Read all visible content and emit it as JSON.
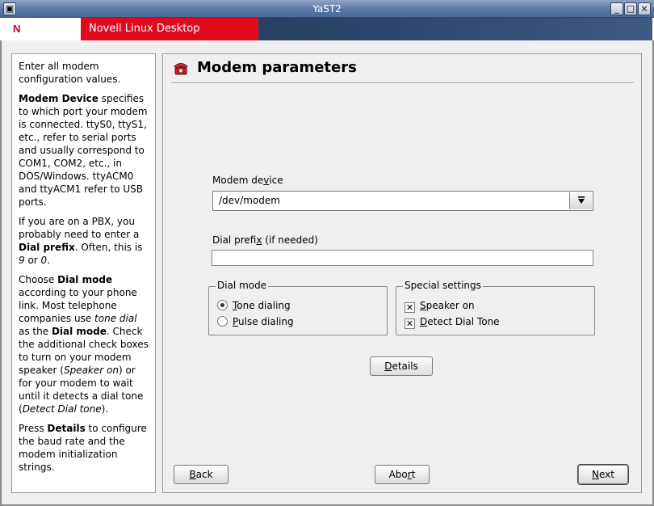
{
  "window": {
    "title": "YaST2",
    "buttons": {
      "menu": "▣",
      "minimize": "_",
      "maximize": "□",
      "close": "×"
    }
  },
  "banner": {
    "logo": "N",
    "product": "Novell Linux Desktop"
  },
  "help": {
    "p1": "Enter all modem configuration values.",
    "p2_bold": "Modem Device",
    "p2_rest": " specifies to which port your modem is connected. ttyS0, ttyS1, etc., refer to serial ports and usually correspond to COM1, COM2, etc., in DOS/Windows. ttyACM0 and ttyACM1 refer to USB ports.",
    "p3_a": "If you are on a PBX, you probably need to enter a ",
    "p3_bold": "Dial prefix",
    "p3_b": ". Often, this is ",
    "p3_i1": "9",
    "p3_c": " or ",
    "p3_i2": "0",
    "p3_d": ".",
    "p4_a": "Choose ",
    "p4_bold1": "Dial mode",
    "p4_b": " according to your phone link. Most telephone companies use ",
    "p4_i1": "tone dial",
    "p4_c": " as the ",
    "p4_bold2": "Dial mode",
    "p4_d": ". Check the additional check boxes to turn on your modem speaker (",
    "p4_i2": "Speaker on",
    "p4_e": ") or for your modem to wait until it detects a dial tone (",
    "p4_i3": "Detect Dial tone",
    "p4_f": ").",
    "p5_a": "Press ",
    "p5_bold": "Details",
    "p5_b": " to configure the baud rate and the modem initialization strings."
  },
  "main": {
    "title": "Modem parameters",
    "title_icon": "phone-icon",
    "modem_device": {
      "label_pre": "Modem de",
      "label_u": "v",
      "label_post": "ice",
      "value": "/dev/modem",
      "drop_icon": "arrow-down-icon"
    },
    "dial_prefix": {
      "label_pre": "Dial prefi",
      "label_u": "x",
      "label_post": " (if needed)",
      "value": ""
    },
    "dial_mode": {
      "title": "Dial mode",
      "tone_u": "T",
      "tone_rest": "one dialing",
      "tone_selected": true,
      "pulse_u": "P",
      "pulse_rest": "ulse dialing",
      "pulse_selected": false
    },
    "special": {
      "title": "Special settings",
      "speaker_u": "S",
      "speaker_rest": "peaker on",
      "speaker_checked": true,
      "detect_u": "D",
      "detect_rest": "etect Dial Tone",
      "detect_checked": true,
      "check_mark": "✕"
    },
    "details": {
      "u": "D",
      "rest": "etails"
    }
  },
  "footer": {
    "back": {
      "u": "B",
      "rest": "ack"
    },
    "abort": {
      "pre": "Abo",
      "u": "r",
      "post": "t"
    },
    "next": {
      "u": "N",
      "rest": "ext"
    }
  },
  "colors": {
    "accent_red": "#e00b1c",
    "banner_blue": "#2e466c"
  }
}
